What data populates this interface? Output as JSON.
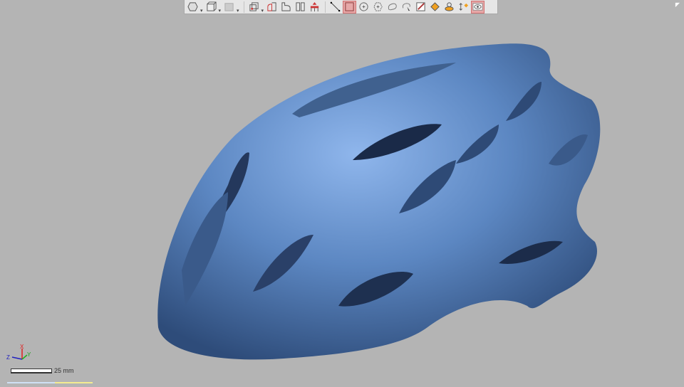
{
  "toolbar": {
    "items": [
      {
        "name": "view-shaded-icon",
        "dropdown": true
      },
      {
        "name": "view-cube-icon",
        "dropdown": true
      },
      {
        "name": "view-box-icon",
        "dropdown": true
      },
      {
        "name": "wireframe-cube-icon",
        "dropdown": true
      },
      {
        "name": "section-plane-icon"
      },
      {
        "name": "section-arc-icon"
      },
      {
        "name": "split-view-icon"
      },
      {
        "name": "align-up-icon"
      },
      {
        "name": "line-select-icon"
      },
      {
        "name": "rectangle-select-icon",
        "active": true
      },
      {
        "name": "circle-select-icon"
      },
      {
        "name": "polygon-select-icon"
      },
      {
        "name": "lasso-select-icon"
      },
      {
        "name": "paint-select-icon"
      },
      {
        "name": "brush-select-icon"
      },
      {
        "name": "fill-select-icon"
      },
      {
        "name": "surface-select-icon"
      },
      {
        "name": "transform-select-icon"
      },
      {
        "name": "visibility-icon",
        "active": true
      }
    ]
  },
  "triad": {
    "x": "X",
    "y": "Y",
    "z": "Z"
  },
  "scale": {
    "label": "25 mm"
  },
  "colors": {
    "model": "#5b86c0",
    "background": "#b4b4b4",
    "accent": "#e6a8a8"
  }
}
